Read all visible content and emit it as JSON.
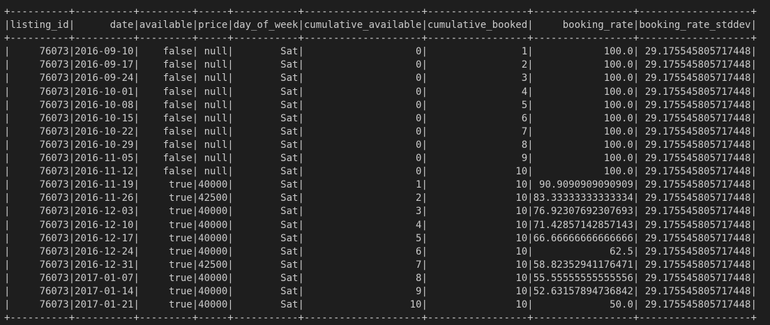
{
  "columns": [
    {
      "name": "listing_id",
      "width": 10
    },
    {
      "name": "date",
      "width": 10
    },
    {
      "name": "available",
      "width": 9
    },
    {
      "name": "price",
      "width": 5
    },
    {
      "name": "day_of_week",
      "width": 11
    },
    {
      "name": "cumulative_available",
      "width": 20
    },
    {
      "name": "cumulative_booked",
      "width": 17
    },
    {
      "name": "booking_rate",
      "width": 17
    },
    {
      "name": "booking_rate_stddev",
      "width": 19
    }
  ],
  "rows": [
    [
      "76073",
      "2016-09-10",
      "false",
      "null",
      "Sat",
      "0",
      "1",
      "100.0",
      "29.175545805717448"
    ],
    [
      "76073",
      "2016-09-17",
      "false",
      "null",
      "Sat",
      "0",
      "2",
      "100.0",
      "29.175545805717448"
    ],
    [
      "76073",
      "2016-09-24",
      "false",
      "null",
      "Sat",
      "0",
      "3",
      "100.0",
      "29.175545805717448"
    ],
    [
      "76073",
      "2016-10-01",
      "false",
      "null",
      "Sat",
      "0",
      "4",
      "100.0",
      "29.175545805717448"
    ],
    [
      "76073",
      "2016-10-08",
      "false",
      "null",
      "Sat",
      "0",
      "5",
      "100.0",
      "29.175545805717448"
    ],
    [
      "76073",
      "2016-10-15",
      "false",
      "null",
      "Sat",
      "0",
      "6",
      "100.0",
      "29.175545805717448"
    ],
    [
      "76073",
      "2016-10-22",
      "false",
      "null",
      "Sat",
      "0",
      "7",
      "100.0",
      "29.175545805717448"
    ],
    [
      "76073",
      "2016-10-29",
      "false",
      "null",
      "Sat",
      "0",
      "8",
      "100.0",
      "29.175545805717448"
    ],
    [
      "76073",
      "2016-11-05",
      "false",
      "null",
      "Sat",
      "0",
      "9",
      "100.0",
      "29.175545805717448"
    ],
    [
      "76073",
      "2016-11-12",
      "false",
      "null",
      "Sat",
      "0",
      "10",
      "100.0",
      "29.175545805717448"
    ],
    [
      "76073",
      "2016-11-19",
      "true",
      "40000",
      "Sat",
      "1",
      "10",
      "90.9090909090909",
      "29.175545805717448"
    ],
    [
      "76073",
      "2016-11-26",
      "true",
      "42500",
      "Sat",
      "2",
      "10",
      "83.33333333333334",
      "29.175545805717448"
    ],
    [
      "76073",
      "2016-12-03",
      "true",
      "40000",
      "Sat",
      "3",
      "10",
      "76.92307692307693",
      "29.175545805717448"
    ],
    [
      "76073",
      "2016-12-10",
      "true",
      "40000",
      "Sat",
      "4",
      "10",
      "71.42857142857143",
      "29.175545805717448"
    ],
    [
      "76073",
      "2016-12-17",
      "true",
      "40000",
      "Sat",
      "5",
      "10",
      "66.66666666666666",
      "29.175545805717448"
    ],
    [
      "76073",
      "2016-12-24",
      "true",
      "40000",
      "Sat",
      "6",
      "10",
      "62.5",
      "29.175545805717448"
    ],
    [
      "76073",
      "2016-12-31",
      "true",
      "42500",
      "Sat",
      "7",
      "10",
      "58.82352941176471",
      "29.175545805717448"
    ],
    [
      "76073",
      "2017-01-07",
      "true",
      "40000",
      "Sat",
      "8",
      "10",
      "55.55555555555556",
      "29.175545805717448"
    ],
    [
      "76073",
      "2017-01-14",
      "true",
      "40000",
      "Sat",
      "9",
      "10",
      "52.63157894736842",
      "29.175545805717448"
    ],
    [
      "76073",
      "2017-01-21",
      "true",
      "40000",
      "Sat",
      "10",
      "10",
      "50.0",
      "29.175545805717448"
    ]
  ]
}
